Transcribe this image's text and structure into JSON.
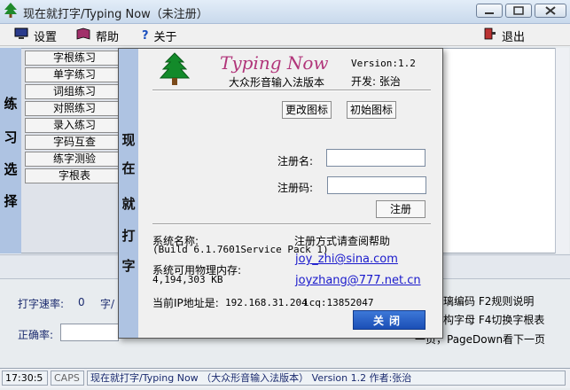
{
  "window": {
    "title": "现在就打字/Typing Now（未注册）"
  },
  "menu": {
    "settings": "设置",
    "help": "帮助",
    "about": "关于",
    "exit": "退出"
  },
  "left_panel": {
    "label_chars": [
      "练",
      "习",
      "选",
      "择"
    ],
    "buttons": [
      "字根练习",
      "单字练习",
      "词组练习",
      "对照练习",
      "录入练习",
      "字码互查",
      "练字测验",
      "字根表"
    ]
  },
  "right_area": {
    "line1": "璃编码  F2规则说明",
    "line2": "构字母 F4切换字根表",
    "line3": "一页，PageDown看下一页"
  },
  "bottom": {
    "speed_label": "打字速率:",
    "speed_value": "0",
    "speed_unit": "字/",
    "accuracy_label": "正确率:"
  },
  "status": {
    "time": "17:30:5",
    "caps": "CAPS",
    "info": "现在就打字/Typing Now （大众形音输入法版本） Version 1.2  作者:张治"
  },
  "dialog": {
    "side_chars": [
      "现",
      "在",
      "就",
      "打",
      "字"
    ],
    "heading": "Typing Now",
    "version": "Version:1.2",
    "subtitle": "大众形音输入法版本",
    "developer": "开发: 张治",
    "change_icon": "更改图标",
    "initial_icon": "初始图标",
    "reg_name_label": "注册名:",
    "reg_code_label": "注册码:",
    "register_button": "注册",
    "system_name_label": "系统名称:",
    "system_name_value": "(Build 6.1.7601Service Pack 1)",
    "reg_method": "注册方式请查阅帮助",
    "email1": "joy_zhi@sina.com",
    "memory_label": "系统可用物理内存:",
    "memory_value": "4,194,303 KB",
    "email2": "joyzhang@777.net.cn",
    "ip_label": "当前IP地址是:",
    "ip_value": "192.168.31.204",
    "icq": "icq:13852047",
    "close_button": "关闭"
  }
}
